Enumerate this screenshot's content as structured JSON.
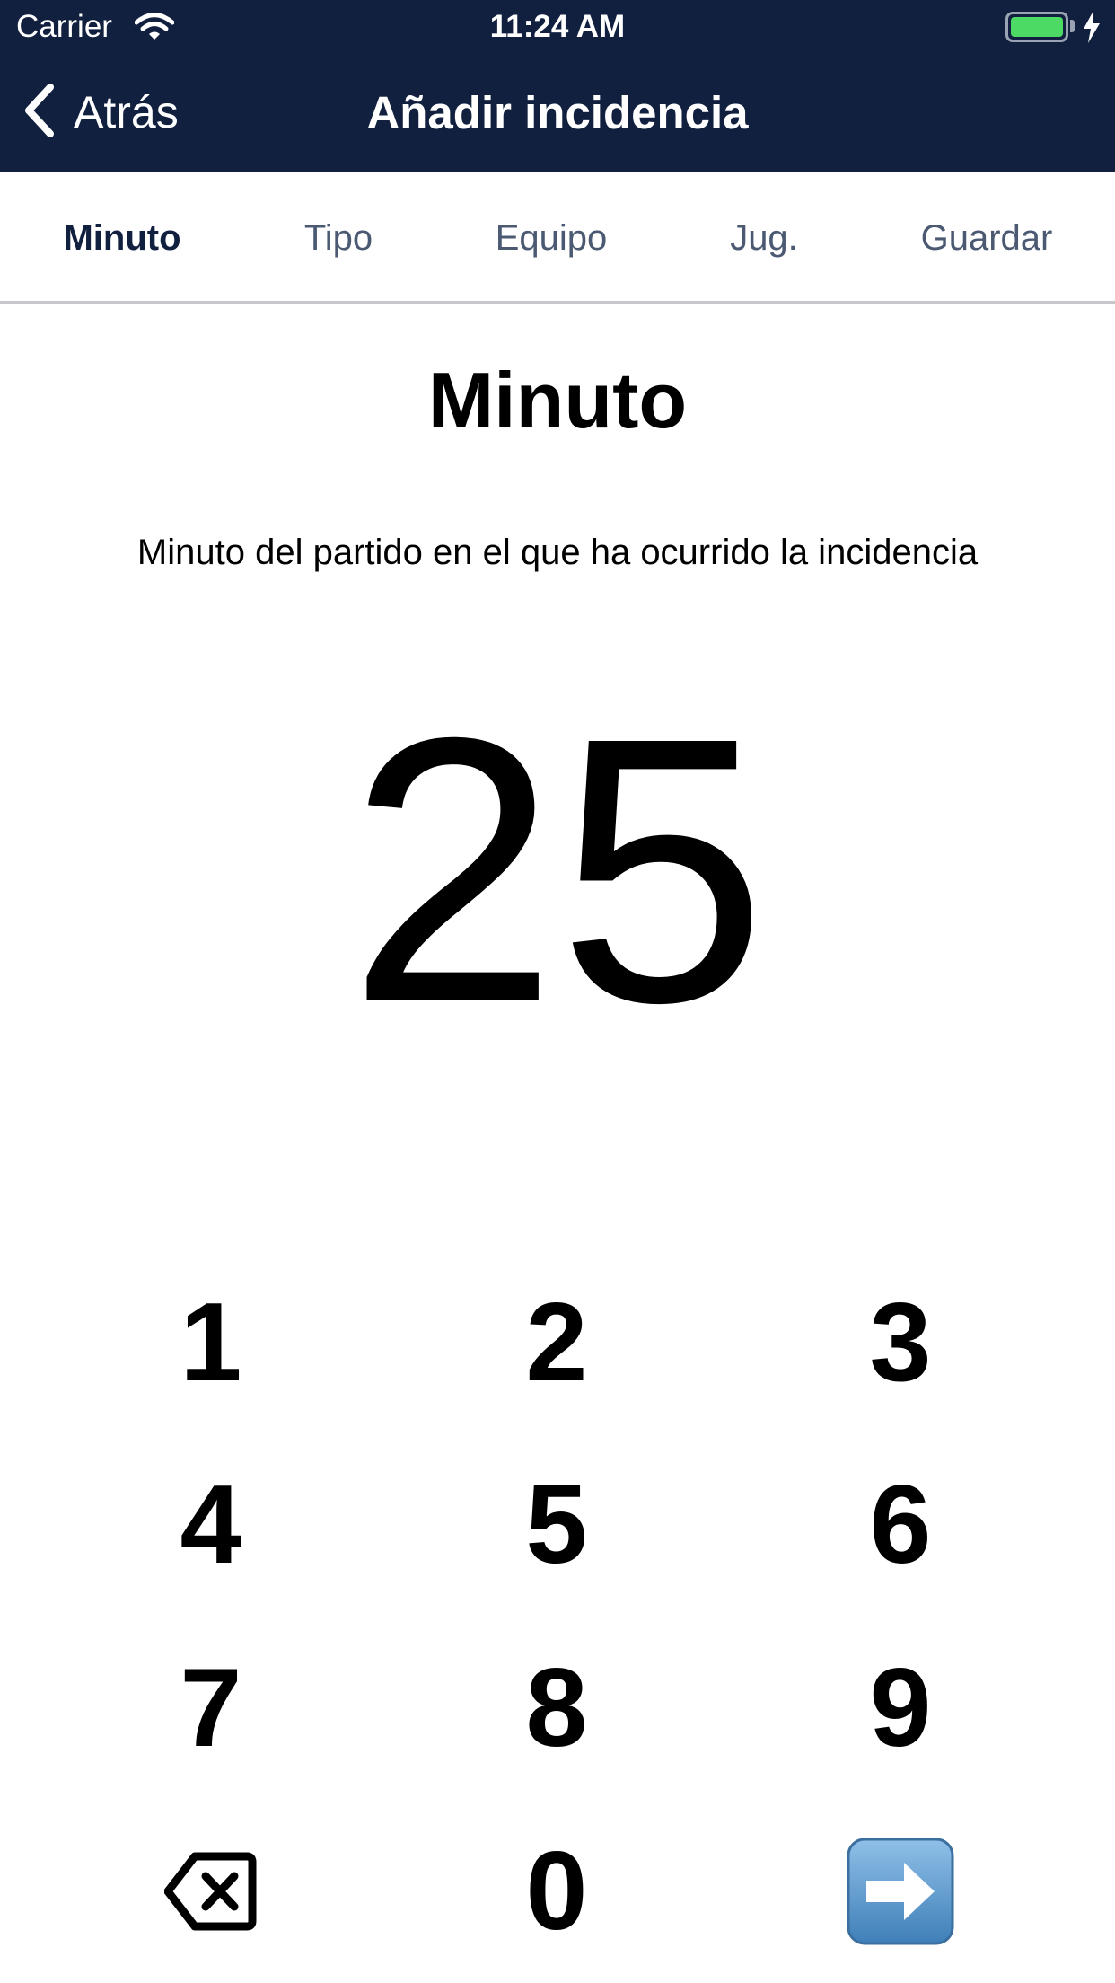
{
  "status_bar": {
    "carrier": "Carrier",
    "time": "11:24 AM",
    "icons": [
      "wifi-icon",
      "battery-icon",
      "charging-bolt-icon"
    ],
    "battery_color": "#4cd964"
  },
  "nav": {
    "back_label": "Atrás",
    "back_icon": "chevron-left-icon",
    "title": "Añadir incidencia",
    "background": "#12203f"
  },
  "tabs": [
    {
      "label": "Minuto",
      "active": true
    },
    {
      "label": "Tipo",
      "active": false
    },
    {
      "label": "Equipo",
      "active": false
    },
    {
      "label": "Jug.",
      "active": false
    },
    {
      "label": "Guardar",
      "active": false
    }
  ],
  "main": {
    "heading": "Minuto",
    "subtitle": "Minuto del partido en el que ha ocurrido la incidencia",
    "value": "25"
  },
  "keypad": {
    "keys": [
      "1",
      "2",
      "3",
      "4",
      "5",
      "6",
      "7",
      "8",
      "9",
      "0"
    ],
    "delete_icon": "backspace-icon",
    "next_icon": "right-arrow-icon",
    "next_color": "#4a8ac0"
  }
}
